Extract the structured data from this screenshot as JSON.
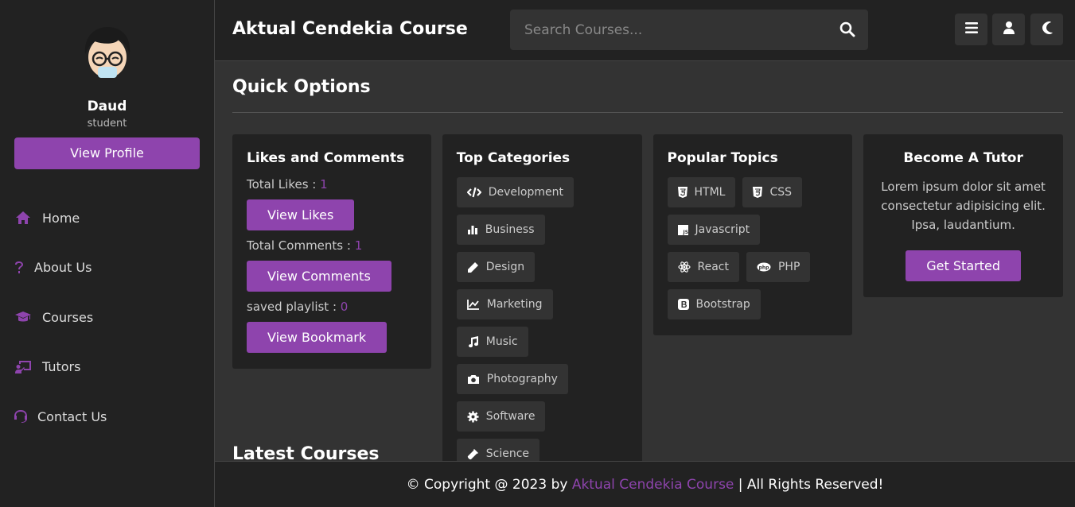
{
  "sidebar": {
    "profile": {
      "name": "Daud",
      "role": "student",
      "view_profile_label": "View Profile"
    },
    "nav": [
      {
        "label": "Home",
        "icon": "home-icon"
      },
      {
        "label": "About Us",
        "icon": "question-icon"
      },
      {
        "label": "Courses",
        "icon": "graduation-cap-icon"
      },
      {
        "label": "Tutors",
        "icon": "chalkboard-teacher-icon"
      },
      {
        "label": "Contact Us",
        "icon": "headset-icon"
      }
    ]
  },
  "header": {
    "brand": "Aktual Cendekia Course",
    "search_placeholder": "Search Courses...",
    "buttons": [
      "menu-icon",
      "user-icon",
      "moon-icon"
    ]
  },
  "main": {
    "quick_options_title": "Quick Options",
    "likes_card": {
      "title": "Likes and Comments",
      "total_likes_label": "Total Likes :",
      "total_likes": "1",
      "view_likes_label": "View Likes",
      "total_comments_label": "Total Comments :",
      "total_comments": "1",
      "view_comments_label": "View Comments",
      "saved_playlist_label": "saved playlist :",
      "saved_playlist": "0",
      "view_bookmark_label": "View Bookmark"
    },
    "categories_card": {
      "title": "Top Categories",
      "items": [
        {
          "label": "Development",
          "icon": "code-icon"
        },
        {
          "label": "Business",
          "icon": "chart-bar-icon"
        },
        {
          "label": "Design",
          "icon": "pen-icon"
        },
        {
          "label": "Marketing",
          "icon": "chart-line-icon"
        },
        {
          "label": "Music",
          "icon": "music-icon"
        },
        {
          "label": "Photography",
          "icon": "camera-icon"
        },
        {
          "label": "Software",
          "icon": "cog-icon"
        },
        {
          "label": "Science",
          "icon": "vial-icon"
        }
      ]
    },
    "topics_card": {
      "title": "Popular Topics",
      "items": [
        {
          "label": "HTML",
          "icon": "html5-icon"
        },
        {
          "label": "CSS",
          "icon": "css3-icon"
        },
        {
          "label": "Javascript",
          "icon": "js-icon"
        },
        {
          "label": "React",
          "icon": "react-icon"
        },
        {
          "label": "PHP",
          "icon": "php-icon"
        },
        {
          "label": "Bootstrap",
          "icon": "bootstrap-icon"
        }
      ]
    },
    "tutor_card": {
      "title": "Become A Tutor",
      "text": "Lorem ipsum dolor sit amet consectetur adipisicing elit. Ipsa, laudantium.",
      "button_label": "Get Started"
    },
    "latest_title": "Latest Courses"
  },
  "footer": {
    "prefix": "© Copyright @ 2023 by",
    "brand": "Aktual Cendekia Course",
    "suffix": "| All Rights Reserved!"
  },
  "colors": {
    "accent": "#8e44ad",
    "panel": "#222222",
    "background": "#333333"
  }
}
